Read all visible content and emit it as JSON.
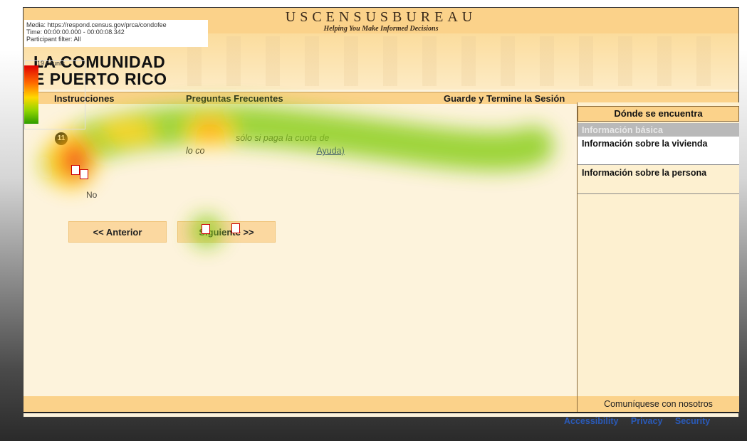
{
  "overlay": {
    "media": "Media: https://respond.census.gov/prca/condofee",
    "time": "Time: 00:00:00.000 - 00:00:08.342",
    "filter": "Participant filter: All",
    "count": "19 counts"
  },
  "banner": {
    "title": "USCENSUSBUREAU",
    "subtitle": "Helping You Make Informed Decisions",
    "site_title_1": "LA COMUNIDAD",
    "site_title_2": "E PUERTO RICO"
  },
  "nav": {
    "instructions": "Instrucciones",
    "faq": "Preguntas Frecuentes",
    "save_exit": "Guarde y Termine la Sesión"
  },
  "sidebar": {
    "header": "Dónde se encuentra",
    "items": [
      {
        "label": "Información básica"
      },
      {
        "label": "Información sobre la vivienda"
      },
      {
        "label": "Información sobre la persona"
      }
    ]
  },
  "question": {
    "icon": "11",
    "line1": "sólo si paga la cuota de",
    "line2_prefix": "lo co",
    "help_link": "Ayuda)",
    "no_option": "No"
  },
  "buttons": {
    "prev": "<<  Anterior",
    "next": "Siguiente  >>"
  },
  "footer": {
    "contact": "Comuníquese con nosotros",
    "links": [
      "Accessibility",
      "Privacy",
      "Security"
    ]
  },
  "colors": {
    "accent": "#fbd28a",
    "page": "#fdf3dc",
    "link": "#2a5ab8"
  }
}
